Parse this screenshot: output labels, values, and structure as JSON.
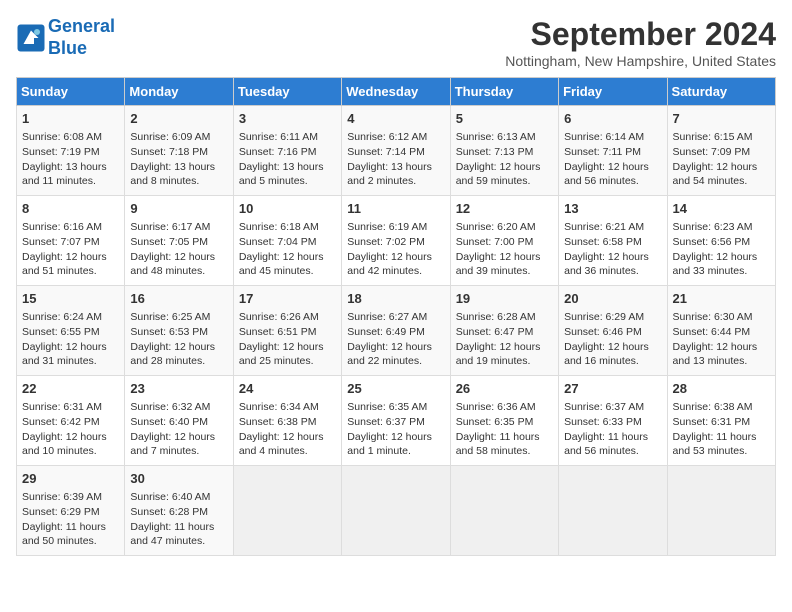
{
  "header": {
    "logo_line1": "General",
    "logo_line2": "Blue",
    "month": "September 2024",
    "location": "Nottingham, New Hampshire, United States"
  },
  "days_of_week": [
    "Sunday",
    "Monday",
    "Tuesday",
    "Wednesday",
    "Thursday",
    "Friday",
    "Saturday"
  ],
  "weeks": [
    [
      {
        "day": "1",
        "info": "Sunrise: 6:08 AM\nSunset: 7:19 PM\nDaylight: 13 hours and 11 minutes."
      },
      {
        "day": "2",
        "info": "Sunrise: 6:09 AM\nSunset: 7:18 PM\nDaylight: 13 hours and 8 minutes."
      },
      {
        "day": "3",
        "info": "Sunrise: 6:11 AM\nSunset: 7:16 PM\nDaylight: 13 hours and 5 minutes."
      },
      {
        "day": "4",
        "info": "Sunrise: 6:12 AM\nSunset: 7:14 PM\nDaylight: 13 hours and 2 minutes."
      },
      {
        "day": "5",
        "info": "Sunrise: 6:13 AM\nSunset: 7:13 PM\nDaylight: 12 hours and 59 minutes."
      },
      {
        "day": "6",
        "info": "Sunrise: 6:14 AM\nSunset: 7:11 PM\nDaylight: 12 hours and 56 minutes."
      },
      {
        "day": "7",
        "info": "Sunrise: 6:15 AM\nSunset: 7:09 PM\nDaylight: 12 hours and 54 minutes."
      }
    ],
    [
      {
        "day": "8",
        "info": "Sunrise: 6:16 AM\nSunset: 7:07 PM\nDaylight: 12 hours and 51 minutes."
      },
      {
        "day": "9",
        "info": "Sunrise: 6:17 AM\nSunset: 7:05 PM\nDaylight: 12 hours and 48 minutes."
      },
      {
        "day": "10",
        "info": "Sunrise: 6:18 AM\nSunset: 7:04 PM\nDaylight: 12 hours and 45 minutes."
      },
      {
        "day": "11",
        "info": "Sunrise: 6:19 AM\nSunset: 7:02 PM\nDaylight: 12 hours and 42 minutes."
      },
      {
        "day": "12",
        "info": "Sunrise: 6:20 AM\nSunset: 7:00 PM\nDaylight: 12 hours and 39 minutes."
      },
      {
        "day": "13",
        "info": "Sunrise: 6:21 AM\nSunset: 6:58 PM\nDaylight: 12 hours and 36 minutes."
      },
      {
        "day": "14",
        "info": "Sunrise: 6:23 AM\nSunset: 6:56 PM\nDaylight: 12 hours and 33 minutes."
      }
    ],
    [
      {
        "day": "15",
        "info": "Sunrise: 6:24 AM\nSunset: 6:55 PM\nDaylight: 12 hours and 31 minutes."
      },
      {
        "day": "16",
        "info": "Sunrise: 6:25 AM\nSunset: 6:53 PM\nDaylight: 12 hours and 28 minutes."
      },
      {
        "day": "17",
        "info": "Sunrise: 6:26 AM\nSunset: 6:51 PM\nDaylight: 12 hours and 25 minutes."
      },
      {
        "day": "18",
        "info": "Sunrise: 6:27 AM\nSunset: 6:49 PM\nDaylight: 12 hours and 22 minutes."
      },
      {
        "day": "19",
        "info": "Sunrise: 6:28 AM\nSunset: 6:47 PM\nDaylight: 12 hours and 19 minutes."
      },
      {
        "day": "20",
        "info": "Sunrise: 6:29 AM\nSunset: 6:46 PM\nDaylight: 12 hours and 16 minutes."
      },
      {
        "day": "21",
        "info": "Sunrise: 6:30 AM\nSunset: 6:44 PM\nDaylight: 12 hours and 13 minutes."
      }
    ],
    [
      {
        "day": "22",
        "info": "Sunrise: 6:31 AM\nSunset: 6:42 PM\nDaylight: 12 hours and 10 minutes."
      },
      {
        "day": "23",
        "info": "Sunrise: 6:32 AM\nSunset: 6:40 PM\nDaylight: 12 hours and 7 minutes."
      },
      {
        "day": "24",
        "info": "Sunrise: 6:34 AM\nSunset: 6:38 PM\nDaylight: 12 hours and 4 minutes."
      },
      {
        "day": "25",
        "info": "Sunrise: 6:35 AM\nSunset: 6:37 PM\nDaylight: 12 hours and 1 minute."
      },
      {
        "day": "26",
        "info": "Sunrise: 6:36 AM\nSunset: 6:35 PM\nDaylight: 11 hours and 58 minutes."
      },
      {
        "day": "27",
        "info": "Sunrise: 6:37 AM\nSunset: 6:33 PM\nDaylight: 11 hours and 56 minutes."
      },
      {
        "day": "28",
        "info": "Sunrise: 6:38 AM\nSunset: 6:31 PM\nDaylight: 11 hours and 53 minutes."
      }
    ],
    [
      {
        "day": "29",
        "info": "Sunrise: 6:39 AM\nSunset: 6:29 PM\nDaylight: 11 hours and 50 minutes."
      },
      {
        "day": "30",
        "info": "Sunrise: 6:40 AM\nSunset: 6:28 PM\nDaylight: 11 hours and 47 minutes."
      },
      {
        "day": "",
        "info": ""
      },
      {
        "day": "",
        "info": ""
      },
      {
        "day": "",
        "info": ""
      },
      {
        "day": "",
        "info": ""
      },
      {
        "day": "",
        "info": ""
      }
    ]
  ]
}
